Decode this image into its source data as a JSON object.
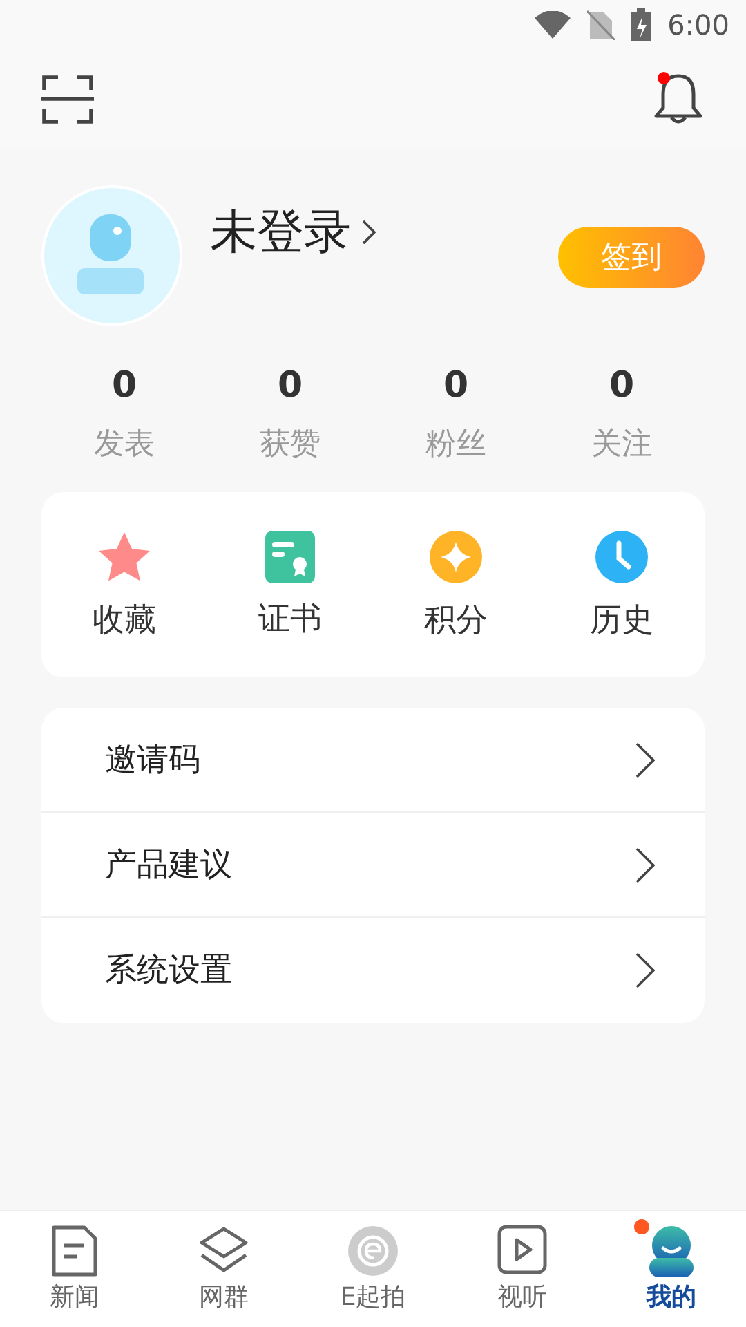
{
  "status_bar": {
    "time": "6:00"
  },
  "header": {
    "has_notification": true
  },
  "profile": {
    "name": "未登录",
    "sign_in": "签到"
  },
  "stats": [
    {
      "value": "0",
      "label": "发表"
    },
    {
      "value": "0",
      "label": "获赞"
    },
    {
      "value": "0",
      "label": "粉丝"
    },
    {
      "value": "0",
      "label": "关注"
    }
  ],
  "shortcuts": [
    {
      "label": "收藏",
      "kind": "star"
    },
    {
      "label": "证书",
      "kind": "certificate"
    },
    {
      "label": "积分",
      "kind": "points"
    },
    {
      "label": "历史",
      "kind": "history"
    }
  ],
  "menu": [
    {
      "label": "邀请码"
    },
    {
      "label": "产品建议"
    },
    {
      "label": "系统设置"
    }
  ],
  "nav": [
    {
      "label": "新闻",
      "kind": "news",
      "selected": false,
      "badge": false
    },
    {
      "label": "网群",
      "kind": "layers",
      "selected": false,
      "badge": false
    },
    {
      "label": "E起拍",
      "kind": "epai",
      "selected": false,
      "badge": false
    },
    {
      "label": "视听",
      "kind": "video",
      "selected": false,
      "badge": false
    },
    {
      "label": "我的",
      "kind": "me",
      "selected": true,
      "badge": true
    }
  ]
}
